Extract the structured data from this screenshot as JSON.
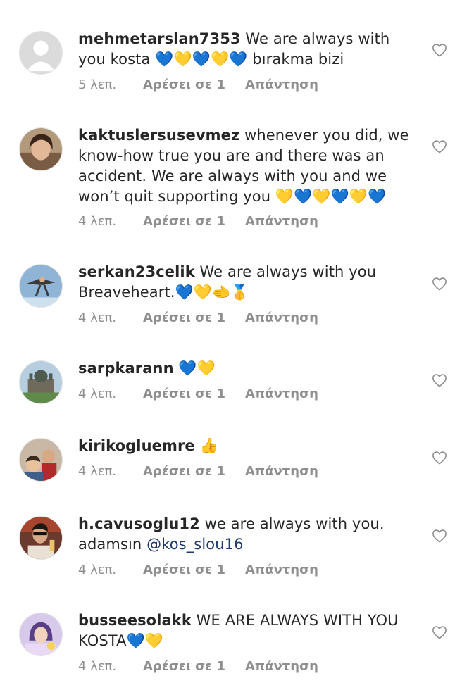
{
  "comments": [
    {
      "user": "mehmetarslan7353",
      "text": " We are always with you kosta 💙💛💙💛💙 bırakma bizi",
      "mention": "",
      "time": "5 λεπ.",
      "likes": "Αρέσει σε 1",
      "reply": "Απάντηση"
    },
    {
      "user": "kaktuslersusevmez",
      "text": " whenever you did, we know-how true you are and there was an accident. We are always with you and we won’t quit supporting you 💛💙💛💙💛💙",
      "mention": "",
      "time": "4 λεπ.",
      "likes": "Αρέσει σε 1",
      "reply": "Απάντηση"
    },
    {
      "user": "serkan23celik",
      "text": " We are always with you Breaveheart.💙💛🫲🥇",
      "mention": "",
      "time": "4 λεπ.",
      "likes": "Αρέσει σε 1",
      "reply": "Απάντηση"
    },
    {
      "user": "sarpkarann",
      "text": " 💙💛",
      "mention": "",
      "time": "4 λεπ.",
      "likes": "Αρέσει σε 1",
      "reply": "Απάντηση"
    },
    {
      "user": "kirikogluemre",
      "text": " 👍",
      "mention": "",
      "time": "4 λεπ.",
      "likes": "Αρέσει σε 1",
      "reply": "Απάντηση"
    },
    {
      "user": "h.cavusoglu12",
      "text": " we are always with you. adamsın ",
      "mention": "@kos_slou16",
      "time": "4 λεπ.",
      "likes": "Αρέσει σε 1",
      "reply": "Απάντηση"
    },
    {
      "user": "busseesolakk",
      "text": " WE ARE ALWAYS WITH YOU KOSTA💙💛",
      "mention": "",
      "time": "4 λεπ.",
      "likes": "Αρέσει σε 1",
      "reply": "Απάντηση"
    }
  ]
}
